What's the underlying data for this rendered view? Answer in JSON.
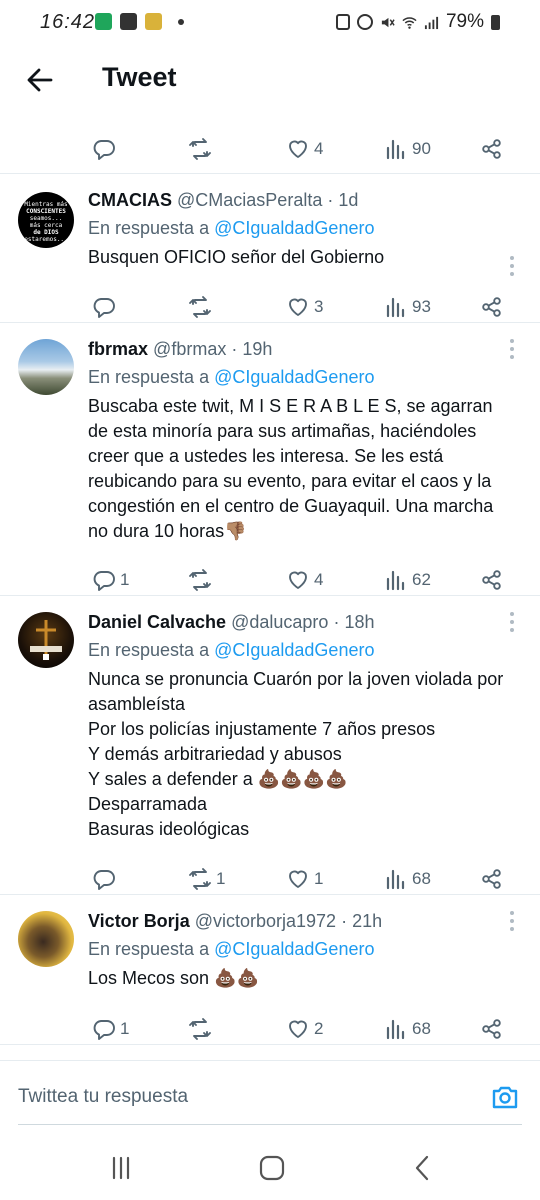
{
  "status_bar": {
    "time": "16:42",
    "battery": "79%"
  },
  "header": {
    "title": "Tweet"
  },
  "colors": {
    "accent": "#1d9bf0",
    "text": "#0f1419",
    "secondary": "#536471"
  },
  "partial_tweet": {
    "replies": "",
    "retweets": "",
    "likes": "4",
    "views": "90"
  },
  "tweets": [
    {
      "name": "CMACIAS",
      "handle": "@CMaciasPeralta",
      "time": "· 1d",
      "reply_prefix": "En respuesta a",
      "reply_to": "@CIgualdadGenero",
      "body": [
        "Busquen OFICIO señor del Gobierno"
      ],
      "replies": "",
      "retweets": "",
      "likes": "3",
      "views": "93",
      "avatar_text": [
        "Mientras más",
        "CONSCIENTES",
        "seamos...",
        "más cerca",
        "de DIOS",
        "estaremos..."
      ]
    },
    {
      "name": "fbrmax",
      "handle": "@fbrmax",
      "time": "· 19h",
      "reply_prefix": "En respuesta a",
      "reply_to": "@CIgualdadGenero",
      "body": [
        "Buscaba este twit, M I S E R A B L E S, se agarran de esta minoría para sus artimañas, haciéndoles creer que a ustedes les interesa. Se les está reubicando para su evento, para evitar el caos y la congestión en el centro de Guayaquil. Una marcha no dura 10 horas👎🏽"
      ],
      "replies": "1",
      "retweets": "",
      "likes": "4",
      "views": "62"
    },
    {
      "name": "Daniel Calvache",
      "handle": "@dalucapro",
      "time": "· 18h",
      "reply_prefix": "En respuesta a",
      "reply_to": "@CIgualdadGenero",
      "body": [
        "Nunca se pronuncia Cuarón por la joven violada por asambleísta",
        "Por los policías injustamente 7 años presos",
        "Y demás arbitrariedad y abusos",
        "Y sales a defender a 💩💩💩💩",
        "Desparramada",
        "Basuras ideológicas"
      ],
      "replies": "",
      "retweets": "1",
      "likes": "1",
      "views": "68"
    },
    {
      "name": "Victor Borja",
      "handle": "@victorborja1972",
      "time": "· 21h",
      "reply_prefix": "En respuesta a",
      "reply_to": "@CIgualdadGenero",
      "body": [
        "Los Mecos son 💩💩"
      ],
      "replies": "1",
      "retweets": "",
      "likes": "2",
      "views": "68"
    }
  ],
  "composer": {
    "placeholder": "Twittea tu respuesta"
  },
  "icons": {
    "back": "arrow-left-icon",
    "reply": "comment-icon",
    "retweet": "retweet-icon",
    "like": "heart-icon",
    "views": "bar-chart-icon",
    "share": "share-icon",
    "camera": "camera-icon",
    "more": "more-vertical-icon"
  }
}
